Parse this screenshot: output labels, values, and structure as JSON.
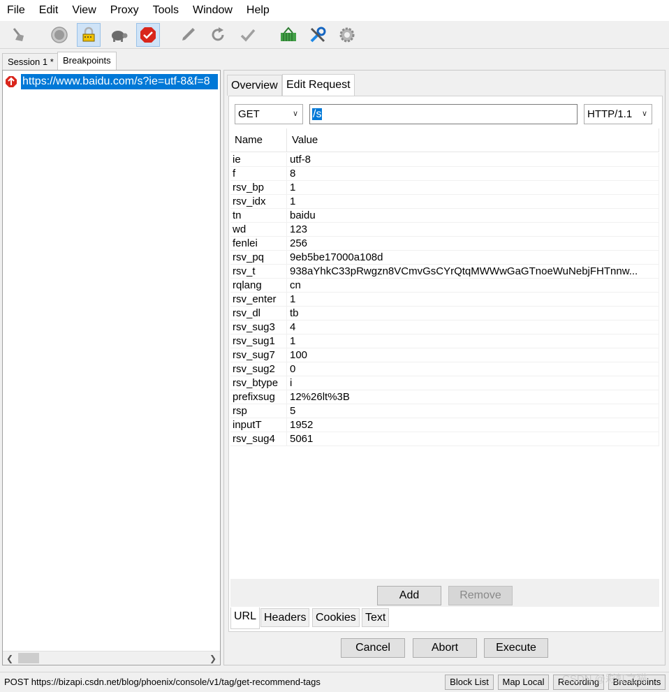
{
  "menu": [
    "File",
    "Edit",
    "View",
    "Proxy",
    "Tools",
    "Window",
    "Help"
  ],
  "toolbar": {
    "icons": [
      "broom-icon",
      "record-icon",
      "ssl-proxy-icon",
      "throttle-turtle-icon",
      "breakpoints-icon",
      "compose-pen-icon",
      "repeat-icon",
      "validate-check-icon",
      "shopping-basket-icon",
      "tools-icon",
      "settings-gear-icon"
    ],
    "accent": "#0078d7"
  },
  "session_tabs": [
    "Session 1 *",
    "Breakpoints"
  ],
  "tree": {
    "selected_url": "https://www.baidu.com/s?ie=utf-8&f=8"
  },
  "right_tabs": [
    "Overview",
    "Edit Request"
  ],
  "request": {
    "method": "GET",
    "path": "/s",
    "protocol": "HTTP/1.1"
  },
  "params_table": {
    "columns": [
      "Name",
      "Value"
    ],
    "rows": [
      {
        "name": "ie",
        "value": "utf-8"
      },
      {
        "name": "f",
        "value": "8"
      },
      {
        "name": "rsv_bp",
        "value": "1"
      },
      {
        "name": "rsv_idx",
        "value": "1"
      },
      {
        "name": "tn",
        "value": "baidu"
      },
      {
        "name": "wd",
        "value": "123"
      },
      {
        "name": "fenlei",
        "value": "256"
      },
      {
        "name": "rsv_pq",
        "value": "9eb5be17000a108d"
      },
      {
        "name": "rsv_t",
        "value": "938aYhkC33pRwgzn8VCmvGsCYrQtqMWWwGaGTnoeWuNebjFHTnnw..."
      },
      {
        "name": "rqlang",
        "value": "cn"
      },
      {
        "name": "rsv_enter",
        "value": "1"
      },
      {
        "name": "rsv_dl",
        "value": "tb"
      },
      {
        "name": "rsv_sug3",
        "value": "4"
      },
      {
        "name": "rsv_sug1",
        "value": "1"
      },
      {
        "name": "rsv_sug7",
        "value": "100"
      },
      {
        "name": "rsv_sug2",
        "value": "0"
      },
      {
        "name": "rsv_btype",
        "value": "i"
      },
      {
        "name": "prefixsug",
        "value": "12%26lt%3B"
      },
      {
        "name": "rsp",
        "value": "5"
      },
      {
        "name": "inputT",
        "value": "1952"
      },
      {
        "name": "rsv_sug4",
        "value": "5061"
      }
    ]
  },
  "table_buttons": {
    "add": "Add",
    "remove": "Remove"
  },
  "sub_tabs": [
    "URL",
    "Headers",
    "Cookies",
    "Text"
  ],
  "actions": {
    "cancel": "Cancel",
    "abort": "Abort",
    "execute": "Execute"
  },
  "status": {
    "text": "POST https://bizapi.csdn.net/blog/phoenix/console/v1/tag/get-recommend-tags",
    "buttons": [
      "Block List",
      "Map Local",
      "Recording",
      "Breakpoints"
    ],
    "watermark": "CSDN @彩虹之猫"
  }
}
